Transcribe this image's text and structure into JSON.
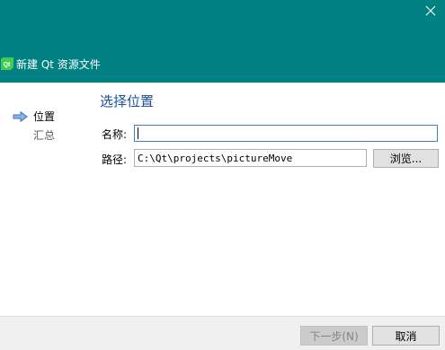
{
  "window": {
    "title": "新建 Qt 资源文件",
    "close_icon": "close-icon",
    "header_color": "#008080"
  },
  "steps": [
    {
      "label": "位置",
      "active": true
    },
    {
      "label": "汇总",
      "active": false
    }
  ],
  "page": {
    "heading": "选择位置",
    "heading_color": "#1b4f9c",
    "name_label": "名称:",
    "name_value": "",
    "path_label": "路径:",
    "path_value": "C:\\Qt\\projects\\pictureMove",
    "browse_label": "浏览..."
  },
  "footer": {
    "next_label": "下一步(N)",
    "cancel_label": "取消"
  }
}
